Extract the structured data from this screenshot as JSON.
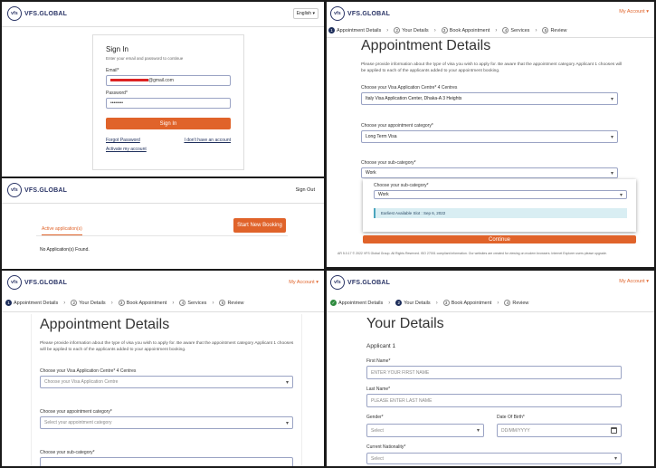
{
  "brand": {
    "logo_mark": "vfs",
    "logo_text": "VFS.GLOBAL"
  },
  "signin": {
    "language": "English",
    "title": "Sign In",
    "subtitle": "Enter your email and password to continue",
    "email_label": "Email*",
    "email_value": "@gmail.com",
    "password_label": "Password*",
    "password_value": "••••••••",
    "signin_button": "Sign In",
    "forgot_link": "Forgot Password",
    "no_account_link": "I don't have an account",
    "activate_link": "Activate my account"
  },
  "dashboard": {
    "signout": "Sign Out",
    "tab_active": "Active application(s)",
    "start_button": "Start New Booking",
    "empty_text": "No Application(s) Found."
  },
  "steps": [
    "Appointment Details",
    "Your Details",
    "Book Appointment",
    "Services",
    "Review"
  ],
  "steps_short": [
    "Appointment Details",
    "Your Details",
    "Book Appointment",
    "Review"
  ],
  "step_numbers": [
    "1",
    "2",
    "3",
    "4",
    "5"
  ],
  "account": "My Account ▾",
  "appointment": {
    "title": "Appointment Details",
    "info": "Please provide information about the type of visa you wish to apply for. Be aware that the appointment category Applicant 1 chooses will be applied to each of the applicants added to your appointment booking.",
    "centre_label": "Choose your Visa Application Centre* 4 Centres",
    "centre_value": "Italy Visa Application Center, Dhaka-A 3 Heights",
    "centre_placeholder": "Choose your Visa Application Centre",
    "category_label": "Choose your appointment category*",
    "category_value": "Long Term Visa",
    "category_placeholder": "Select your appointment category",
    "subcategory_label": "Choose your sub-category*",
    "subcategory_value": "Work",
    "earliest": "Earliest Available Slot : Sep 6, 2022",
    "continue_button": "Continue",
    "footer": "AR 5.0.17 © 2022 VFS Global Group. All Rights Reserved. ISO 27001 compliant information. Our websites are created for viewing on modern browsers. Internet Explorer users please upgrade."
  },
  "details": {
    "title": "Your Details",
    "applicant": "Applicant 1",
    "first_name_label": "First Name*",
    "first_name_placeholder": "ENTER YOUR FIRST NAME",
    "last_name_label": "Last Name*",
    "last_name_placeholder": "PLEASE ENTER LAST NAME",
    "gender_label": "Gender*",
    "gender_placeholder": "Select",
    "dob_label": "Date Of Birth*",
    "dob_placeholder": "DD/MM/YYYY",
    "nationality_label": "Current Nationality*",
    "nationality_placeholder": "Select"
  },
  "colors": {
    "accent": "#e0632a",
    "brand": "#2a3466",
    "success": "#2e8b3e"
  }
}
